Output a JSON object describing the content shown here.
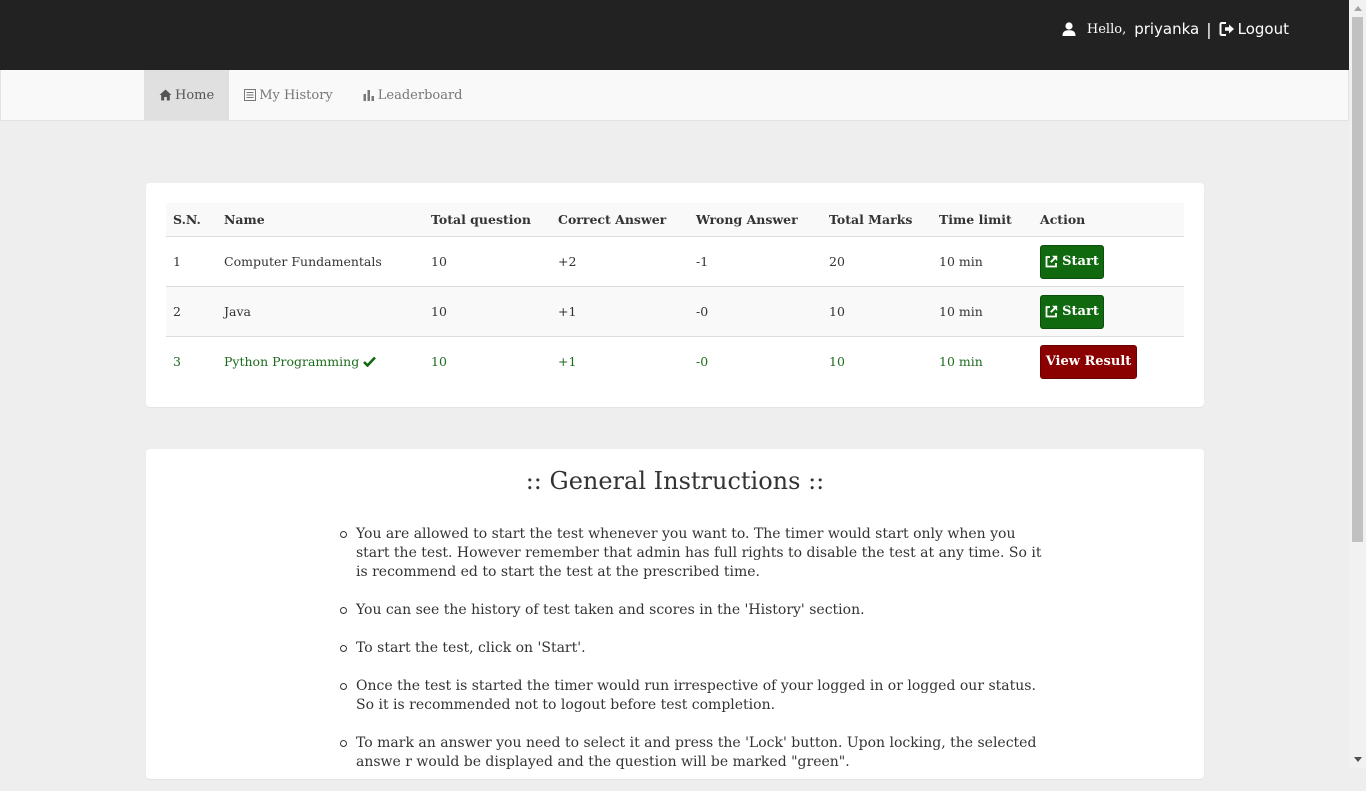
{
  "header": {
    "hello": "Hello,",
    "username": "priyanka",
    "separator": "|",
    "logout": "Logout"
  },
  "nav": {
    "items": [
      {
        "label": "Home",
        "icon": "home-icon",
        "active": true
      },
      {
        "label": "My History",
        "icon": "list-icon",
        "active": false
      },
      {
        "label": "Leaderboard",
        "icon": "bar-chart-icon",
        "active": false
      }
    ]
  },
  "tests": {
    "headers": [
      "S.N.",
      "Name",
      "Total question",
      "Correct Answer",
      "Wrong Answer",
      "Total Marks",
      "Time limit",
      "Action"
    ],
    "rows": [
      {
        "sn": "1",
        "name": "Computer Fundamentals",
        "total": "10",
        "correct": "+2",
        "wrong": "-1",
        "marks": "20",
        "time": "10 min",
        "action": "Start",
        "completed": false
      },
      {
        "sn": "2",
        "name": "Java",
        "total": "10",
        "correct": "+1",
        "wrong": "-0",
        "marks": "10",
        "time": "10 min",
        "action": "Start",
        "completed": false
      },
      {
        "sn": "3",
        "name": "Python Programming",
        "total": "10",
        "correct": "+1",
        "wrong": "-0",
        "marks": "10",
        "time": "10 min",
        "action": "View Result",
        "completed": true
      }
    ],
    "colors": {
      "start": "#11690f",
      "result": "#8b0000",
      "completed_text": "#1d6b1d"
    }
  },
  "instructions": {
    "title": ":: General Instructions ::",
    "items": [
      "You are allowed to start the test whenever you want to. The timer would start only when you start the test. However remember that admin has full rights to disable the test at any time. So it is recommend ed to start the test at the prescribed time.",
      "You can see the history of test taken and scores in the 'History' section.",
      "To start the test, click on 'Start'.",
      "Once the test is started the timer would run irrespective of your logged in or logged our status. So it is recommended not to logout before test completion.",
      "To mark an answer you need to select it and press the 'Lock' button. Upon locking, the selected answe r would be displayed and the question will be marked \"green\"."
    ]
  }
}
